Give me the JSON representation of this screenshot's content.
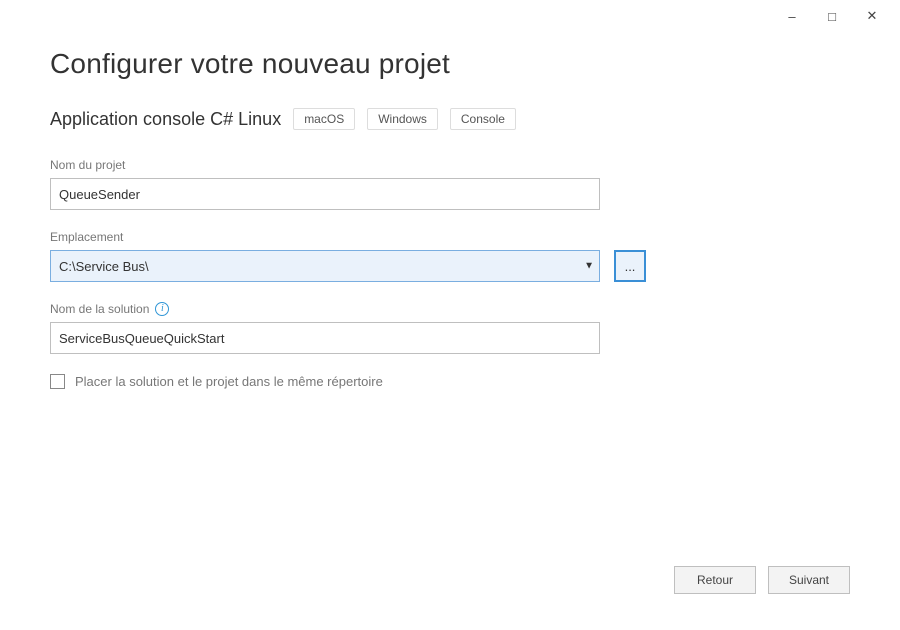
{
  "window": {
    "minimize": "–",
    "maximize": "□",
    "close": "✕"
  },
  "header": {
    "title": "Configurer votre nouveau projet"
  },
  "template": {
    "name": "Application console",
    "lang": "C#",
    "os": "Linux",
    "tags": [
      "macOS",
      "Windows",
      "Console"
    ]
  },
  "fields": {
    "projectName": {
      "label": "Nom du projet",
      "value": "QueueSender"
    },
    "location": {
      "label": "Emplacement",
      "value": "C:\\Service Bus\\",
      "browseLabel": "..."
    },
    "solutionName": {
      "label": "Nom de la solution",
      "value": "ServiceBusQueueQuickStart"
    },
    "sameDir": {
      "label": "Placer la solution et le projet dans le même répertoire",
      "checked": false
    }
  },
  "footer": {
    "back": "Retour",
    "next": "Suivant"
  }
}
